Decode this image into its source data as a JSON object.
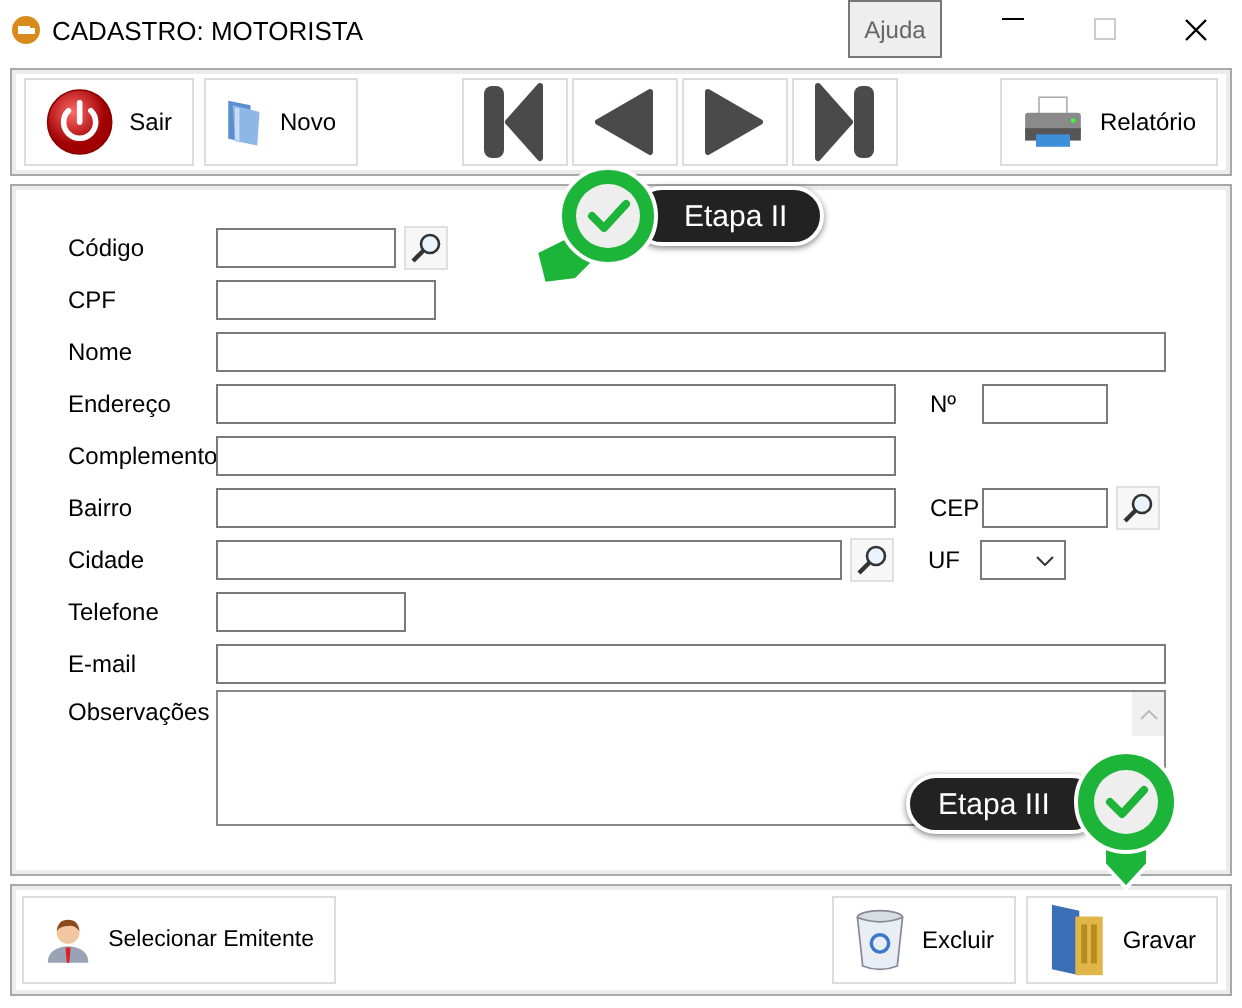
{
  "window": {
    "title": "CADASTRO: MOTORISTA",
    "help_button": "Ajuda",
    "maximize_disabled": true
  },
  "toolbar": {
    "left": [
      {
        "label": "Sair"
      },
      {
        "label": "Novo"
      }
    ],
    "right": [
      {
        "label": "Relatório"
      }
    ]
  },
  "form": {
    "rows": [
      {
        "label": "Código",
        "kind": "text",
        "search": true
      },
      {
        "label": "CPF",
        "kind": "text",
        "search": false
      },
      {
        "label": "Nome",
        "kind": "text",
        "search": false
      },
      {
        "label": "Endereço",
        "kind": "text",
        "search": false,
        "extra": {
          "label": "Nº",
          "kind": "text",
          "search": false
        }
      },
      {
        "label": "Complemento",
        "kind": "text",
        "search": false
      },
      {
        "label": "Bairro",
        "kind": "text",
        "search": false,
        "extra": {
          "label": "CEP",
          "kind": "text",
          "search": true
        }
      },
      {
        "label": "Cidade",
        "kind": "text",
        "search": true,
        "extra": {
          "label": "UF",
          "kind": "select",
          "search": false
        }
      },
      {
        "label": "Telefone",
        "kind": "text",
        "search": false
      },
      {
        "label": "E-mail",
        "kind": "text",
        "search": false
      },
      {
        "label": "Observações",
        "kind": "textarea",
        "search": false
      }
    ]
  },
  "bottom": {
    "left": [
      {
        "label": "Selecionar Emitente"
      }
    ],
    "right": [
      {
        "label": "Excluir"
      },
      {
        "label": "Gravar"
      }
    ]
  },
  "callouts": [
    {
      "text": "Etapa II"
    },
    {
      "text": "Etapa III"
    }
  ]
}
